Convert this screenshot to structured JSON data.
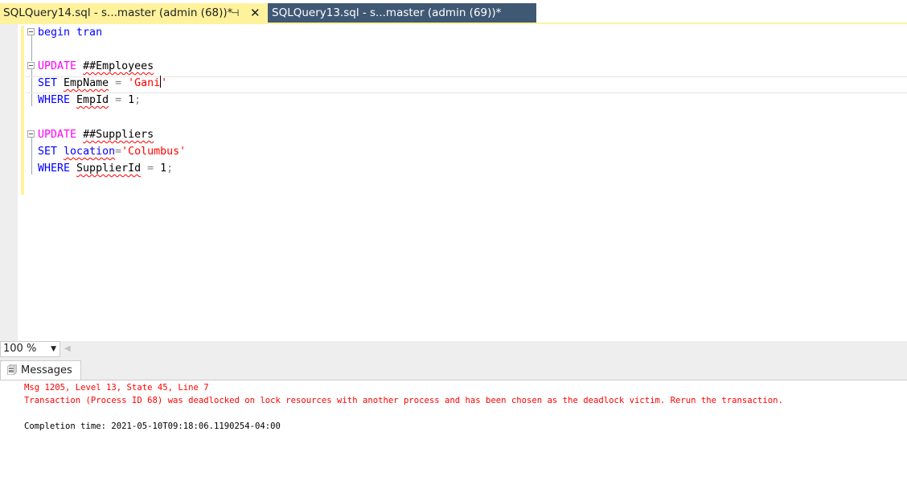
{
  "tabs": {
    "active_label": "SQLQuery14.sql - s...master (admin (68))*",
    "inactive_label": "SQLQuery13.sql - s...master (admin (69))*",
    "pin_glyph": "⊣",
    "close_glyph": "✕"
  },
  "code": {
    "line1": {
      "kw1": "begin",
      "kw2": "tran"
    },
    "line3": {
      "kw": "UPDATE",
      "obj": "##Employees"
    },
    "line4": {
      "kw": "SET",
      "col": "EmpName",
      "op": "=",
      "val": "'Gani'"
    },
    "line5": {
      "kw": "WHERE",
      "col": "EmpId",
      "op": "=",
      "num": "1",
      "end": ";"
    },
    "line7": {
      "kw": "UPDATE",
      "obj": "##Suppliers"
    },
    "line8": {
      "kw": "SET",
      "col": "location",
      "op": "=",
      "val": "'Columbus'"
    },
    "line9": {
      "kw": "WHERE",
      "col": "SupplierId",
      "op": "=",
      "num": "1",
      "end": ";"
    }
  },
  "zoom": {
    "value": "100 %"
  },
  "results": {
    "tab_label": "Messages",
    "line1": "Msg 1205, Level 13, State 45, Line 7",
    "line2": "Transaction (Process ID 68) was deadlocked on lock resources with another process and has been chosen as the deadlock victim. Rerun the transaction.",
    "line3": "Completion time: 2021-05-10T09:18:06.1190254-04:00"
  },
  "colors": {
    "active_tab": "#fff29d",
    "inactive_tab": "#3f5874",
    "keyword": "#0000ff",
    "keyword_pink": "#ff00ff",
    "string": "#ff0000",
    "error_text": "#ff0000"
  },
  "icons": {
    "pin": "pin-icon",
    "close": "close-icon",
    "messages": "messages-icon",
    "dropdown": "chevron-down-icon"
  }
}
